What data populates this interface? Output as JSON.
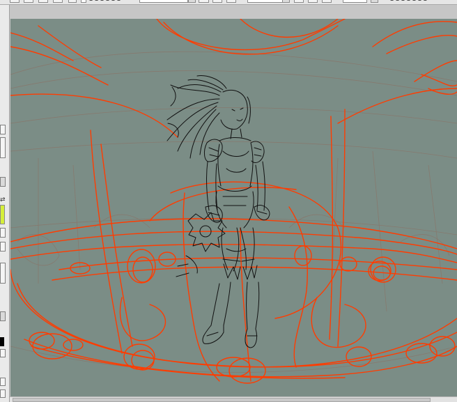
{
  "app": {
    "title": ""
  },
  "toolbar": {
    "icons": [
      "tool-icon",
      "tool-icon",
      "tool-icon",
      "checkbox-icon",
      "dropdown-icon",
      "tool-icon",
      "dropdown-icon",
      "spin-icon"
    ]
  },
  "left_panel": {
    "primary_color": "#d6ef3a",
    "secondary_color": "#000000",
    "swap_glyph": "⇄"
  },
  "canvas": {
    "background": "#7b8d86",
    "sketch_color": "#ff3c00",
    "lineart_color": "#111111",
    "subject": "armored-girl-lineart"
  }
}
